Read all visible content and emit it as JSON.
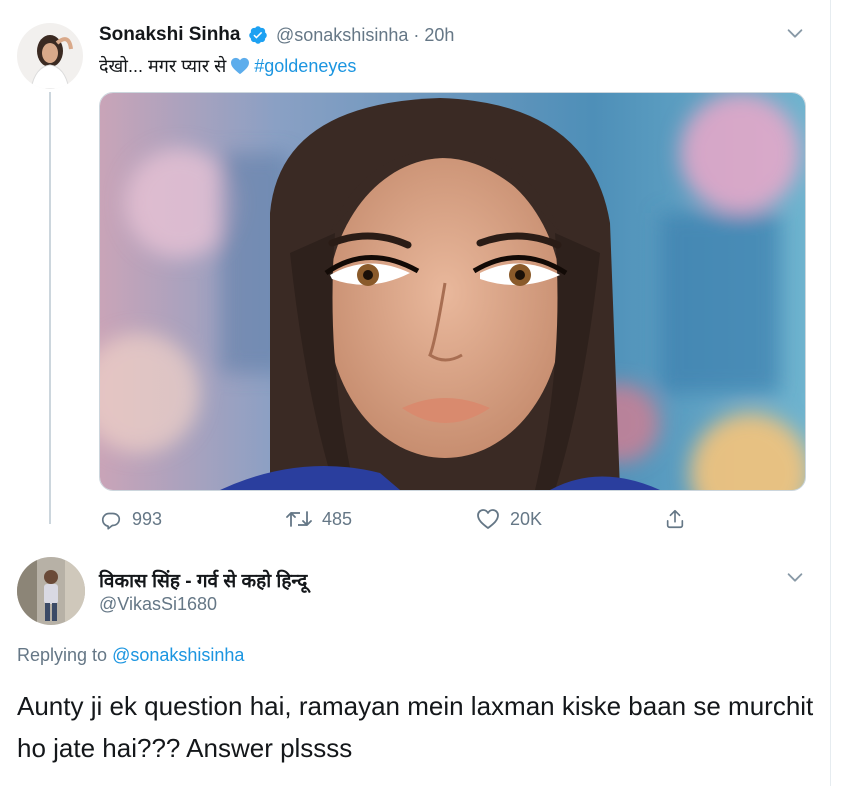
{
  "colors": {
    "accent": "#1b95e0",
    "muted": "#657786",
    "text": "#14171a",
    "border": "#e6ecf0"
  },
  "tweet": {
    "author_name": "Sonakshi Sinha",
    "handle": "@sonakshisinha",
    "separator": "·",
    "time": "20h",
    "text_prefix": "देखो... मगर प्यार से",
    "emoji": "blue-heart-icon",
    "hashtag": "#goldeneyes",
    "media_icon": "portrait-photo",
    "replies": "993",
    "retweets": "485",
    "likes": "20K"
  },
  "reply": {
    "author_name": "विकास सिंह - गर्व से कहो हिन्दू",
    "handle": "@VikasSi1680",
    "replying_label": "Replying to",
    "replying_to": "@sonakshisinha",
    "text": "Aunty ji ek question hai, ramayan mein laxman kiske baan se murchit ho jate hai??? Answer plssss"
  }
}
